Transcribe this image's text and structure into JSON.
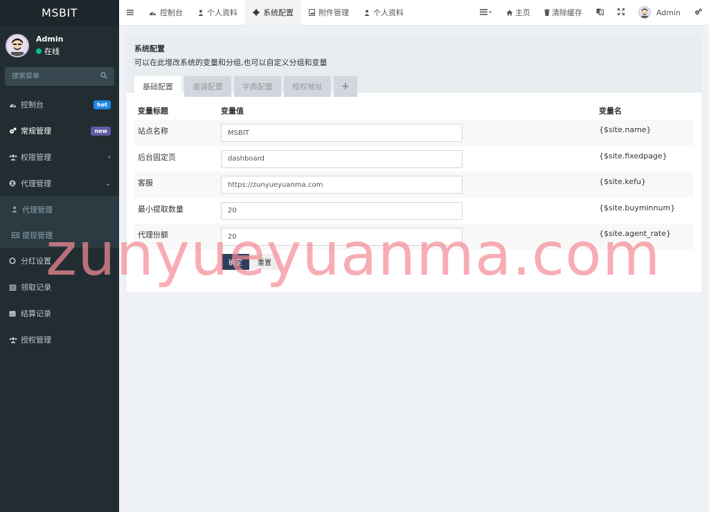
{
  "brand": "MSBIT",
  "user": {
    "name": "Admin",
    "status": "在线"
  },
  "search": {
    "placeholder": "搜索菜单"
  },
  "sidebar": {
    "items": [
      {
        "label": "控制台",
        "icon": "dashboard-icon",
        "badge": "hot"
      },
      {
        "label": "常规管理",
        "icon": "cogs-icon",
        "badge": "new"
      },
      {
        "label": "权限管理",
        "icon": "group-icon"
      },
      {
        "label": "代理管理",
        "icon": "user-circle-icon"
      }
    ],
    "sub_items": [
      {
        "label": "代理管理",
        "icon": "user-icon"
      },
      {
        "label": "提现管理",
        "icon": "card-icon"
      }
    ],
    "items_after": [
      {
        "label": "分红设置",
        "icon": "circle-icon"
      },
      {
        "label": "领取记录",
        "icon": "bank-icon"
      },
      {
        "label": "结算记录",
        "icon": "cc-icon"
      },
      {
        "label": "授权管理",
        "icon": "group-icon"
      }
    ]
  },
  "topnav": {
    "tabs": [
      {
        "label": "控制台",
        "icon": "dashboard-icon"
      },
      {
        "label": "个人资料",
        "icon": "user-icon"
      },
      {
        "label": "系统配置",
        "icon": "gear-icon"
      },
      {
        "label": "附件管理",
        "icon": "image-file-icon"
      },
      {
        "label": "个人资料",
        "icon": "user-icon"
      }
    ],
    "home": "主页",
    "clear_cache": "清除缓存",
    "admin": "Admin"
  },
  "panel": {
    "title": "系统配置",
    "description": "可以在此增改系统的变量和分组,也可以自定义分组和变量",
    "tabs": [
      "基础配置",
      "邀请配置",
      "字典配置",
      "授权地址",
      "+"
    ]
  },
  "table": {
    "headers": [
      "变量标题",
      "变量值",
      "变量名"
    ],
    "rows": [
      {
        "title": "站点名称",
        "value": "MSBIT",
        "var": "{$site.name}"
      },
      {
        "title": "后台固定页",
        "value": "dashboard",
        "var": "{$site.fixedpage}"
      },
      {
        "title": "客服",
        "value": "https://zunyueyuanma.com",
        "var": "{$site.kefu}"
      },
      {
        "title": "最小提取数量",
        "value": "20",
        "var": "{$site.buyminnum}"
      },
      {
        "title": "代理份额",
        "value": "20",
        "var": "{$site.agent_rate}"
      }
    ]
  },
  "buttons": {
    "ok": "确定",
    "reset": "重置"
  },
  "watermark": "zunyueyuanma.com"
}
